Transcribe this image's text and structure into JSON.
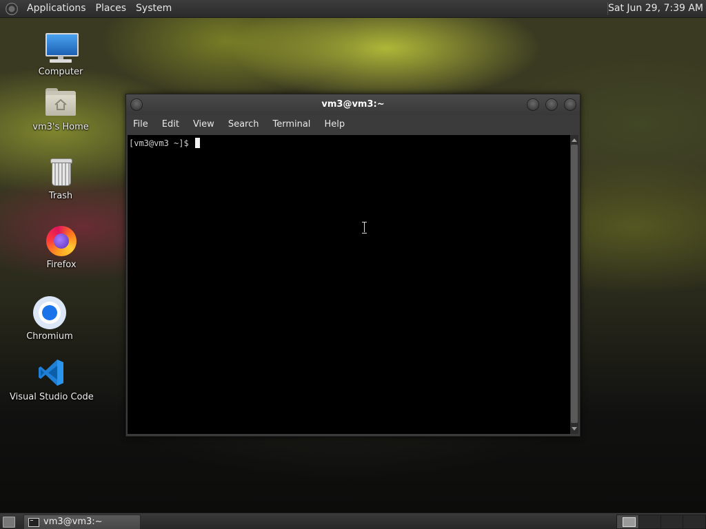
{
  "top_panel": {
    "menu": [
      "Applications",
      "Places",
      "System"
    ],
    "clock": "Sat Jun 29,  7:39 AM"
  },
  "desktop": {
    "icons": [
      {
        "label": "Computer",
        "icon": "computer-icon"
      },
      {
        "label": "vm3's Home",
        "icon": "home-folder-icon"
      },
      {
        "label": "Trash",
        "icon": "trash-icon"
      },
      {
        "label": "Firefox",
        "icon": "firefox-icon"
      },
      {
        "label": "Chromium",
        "icon": "chromium-icon"
      },
      {
        "label": "Visual Studio Code",
        "icon": "vscode-icon"
      }
    ]
  },
  "terminal": {
    "title": "vm3@vm3:~",
    "menu": [
      "File",
      "Edit",
      "View",
      "Search",
      "Terminal",
      "Help"
    ],
    "prompt": "[vm3@vm3 ~]$ "
  },
  "bottom_panel": {
    "task_label": "vm3@vm3:~",
    "workspaces": 4,
    "active_workspace": 1
  },
  "colors": {
    "panel": "#2e2e2e",
    "terminal_bg": "#000000",
    "terminal_fg": "#d0d0d0"
  }
}
